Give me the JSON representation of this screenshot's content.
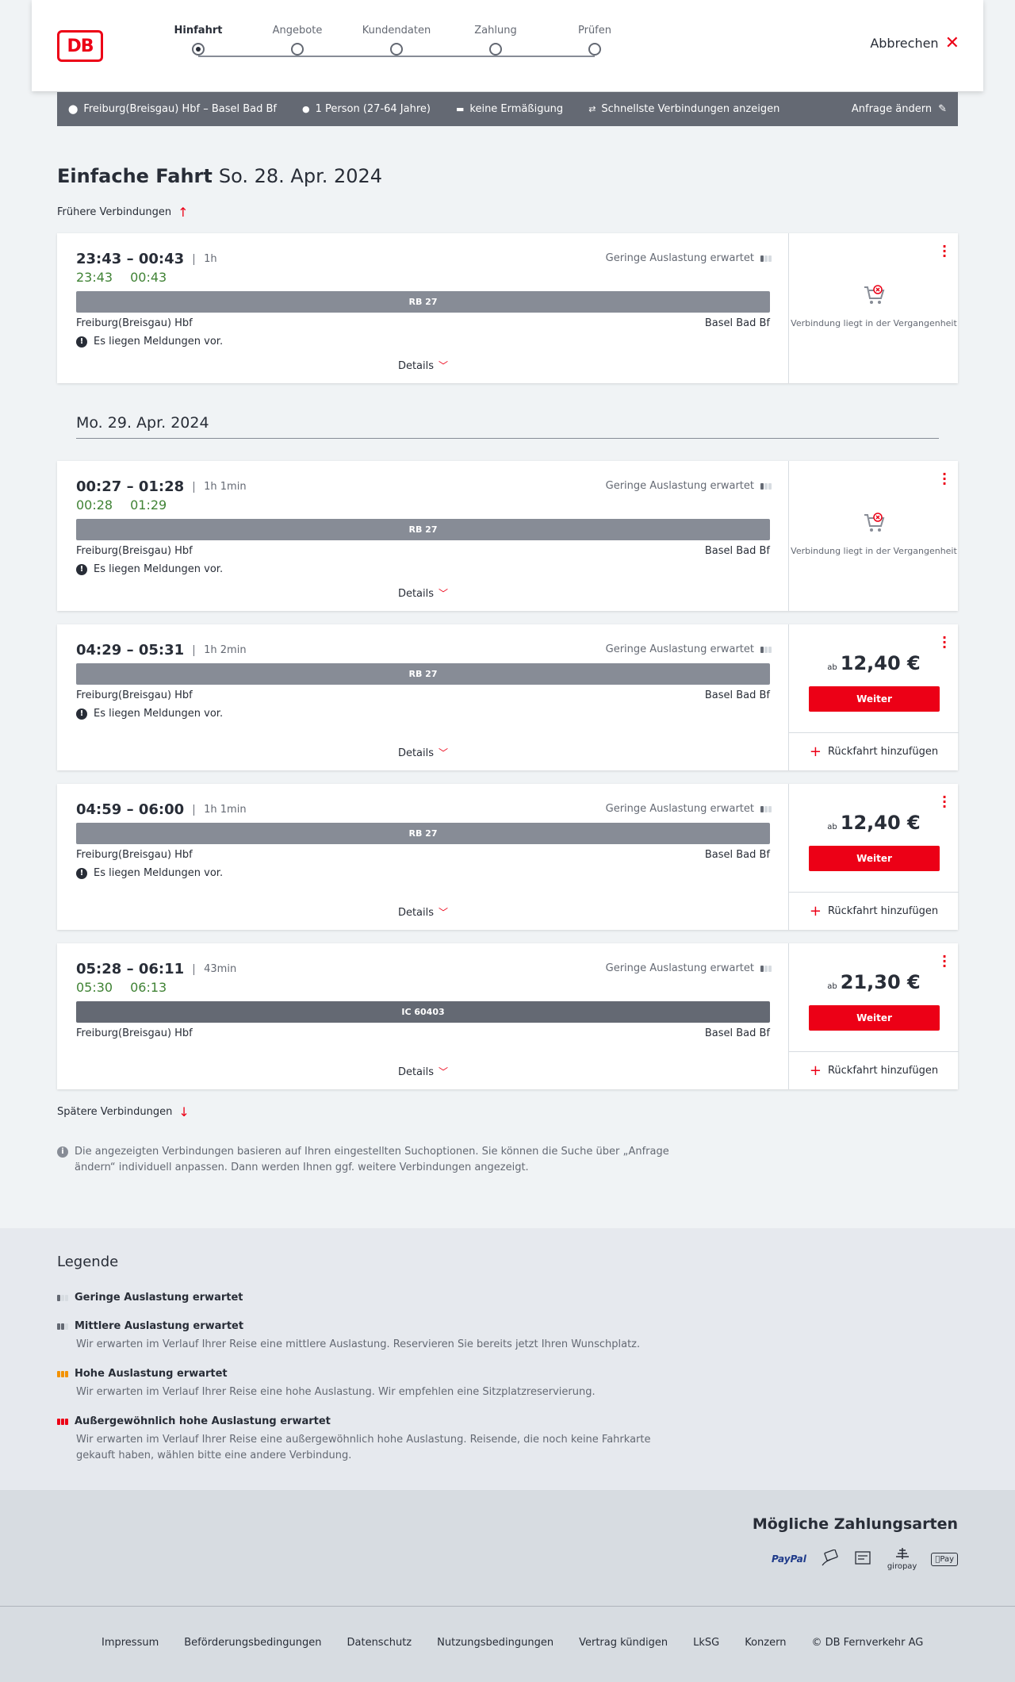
{
  "header": {
    "logo": "DB",
    "steps": [
      {
        "label": "Hinfahrt",
        "active": true
      },
      {
        "label": "Angebote",
        "active": false
      },
      {
        "label": "Kundendaten",
        "active": false
      },
      {
        "label": "Zahlung",
        "active": false
      },
      {
        "label": "Prüfen",
        "active": false
      }
    ],
    "cancel_label": "Abbrechen"
  },
  "search": {
    "route": "Freiburg(Breisgau) Hbf – Basel Bad Bf",
    "travellers": "1 Person (27-64 Jahre)",
    "discount": "keine Ermäßigung",
    "option": "Schnellste Verbindungen anzeigen",
    "change_label": "Anfrage ändern"
  },
  "heading": {
    "title": "Einfache Fahrt",
    "date": "So. 28. Apr. 2024"
  },
  "earlier_label": "Frühere Verbindungen",
  "later_label": "Spätere Verbindungen",
  "date_separator": "Mo. 29. Apr. 2024",
  "connections": [
    {
      "times": "23:43 – 00:43",
      "duration": "1h",
      "realtime_dep": "23:43",
      "realtime_arr": "00:43",
      "occupancy": "Geringe Auslastung erwartet",
      "train": "RB 27",
      "from": "Freiburg(Breisgau) Hbf",
      "to": "Basel Bad Bf",
      "message": "Es liegen Meldungen vor.",
      "details": "Details",
      "past_text": "Verbindung liegt in der Vergangenheit"
    },
    {
      "times": "00:27 – 01:28",
      "duration": "1h 1min",
      "realtime_dep": "00:28",
      "realtime_arr": "01:29",
      "occupancy": "Geringe Auslastung erwartet",
      "train": "RB 27",
      "from": "Freiburg(Breisgau) Hbf",
      "to": "Basel Bad Bf",
      "message": "Es liegen Meldungen vor.",
      "details": "Details",
      "past_text": "Verbindung liegt in der Vergangenheit"
    },
    {
      "times": "04:29 – 05:31",
      "duration": "1h 2min",
      "occupancy": "Geringe Auslastung erwartet",
      "train": "RB 27",
      "from": "Freiburg(Breisgau) Hbf",
      "to": "Basel Bad Bf",
      "message": "Es liegen Meldungen vor.",
      "details": "Details",
      "price_prefix": "ab",
      "price": "12,40 €",
      "button": "Weiter",
      "return_label": "Rückfahrt hinzufügen"
    },
    {
      "times": "04:59 – 06:00",
      "duration": "1h 1min",
      "occupancy": "Geringe Auslastung erwartet",
      "train": "RB 27",
      "from": "Freiburg(Breisgau) Hbf",
      "to": "Basel Bad Bf",
      "message": "Es liegen Meldungen vor.",
      "details": "Details",
      "price_prefix": "ab",
      "price": "12,40 €",
      "button": "Weiter",
      "return_label": "Rückfahrt hinzufügen"
    },
    {
      "times": "05:28 – 06:11",
      "duration": "43min",
      "realtime_dep": "05:30",
      "realtime_arr": "06:13",
      "occupancy": "Geringe Auslastung erwartet",
      "train": "IC 60403",
      "from": "Freiburg(Breisgau) Hbf",
      "to": "Basel Bad Bf",
      "details": "Details",
      "price_prefix": "ab",
      "price": "21,30 €",
      "button": "Weiter",
      "return_label": "Rückfahrt hinzufügen"
    }
  ],
  "info_text": "Die angezeigten Verbindungen basieren auf Ihren eingestellten Suchoptionen. Sie können die Suche über „Anfrage ändern“ individuell anpassen. Dann werden Ihnen ggf. weitere Verbindungen angezeigt.",
  "legend": {
    "title": "Legende",
    "items": [
      {
        "title": "Geringe Auslastung erwartet",
        "text": ""
      },
      {
        "title": "Mittlere Auslastung erwartet",
        "text": "Wir erwarten im Verlauf Ihrer Reise eine mittlere Auslastung. Reservieren Sie bereits jetzt Ihren Wunschplatz."
      },
      {
        "title": "Hohe Auslastung erwartet",
        "text": "Wir erwarten im Verlauf Ihrer Reise eine hohe Auslastung. Wir empfehlen eine Sitzplatzreservierung."
      },
      {
        "title": "Außergewöhnlich hohe Auslastung erwartet",
        "text": "Wir erwarten im Verlauf Ihrer Reise eine außergewöhnlich hohe Auslastung. Reisende, die noch keine Fahrkarte gekauft haben, wählen bitte eine andere Verbindung."
      }
    ],
    "colors": {
      "low": "#646973",
      "mid": "#646973",
      "high": "#f39200",
      "extreme": "#ec0016"
    }
  },
  "payment": {
    "title": "Mögliche Zahlungsarten",
    "methods": [
      "PayPal",
      "giropay",
      "Pay"
    ]
  },
  "footer": {
    "links": [
      "Impressum",
      "Beförderungsbedingungen",
      "Datenschutz",
      "Nutzungsbedingungen",
      "Vertrag kündigen",
      "LkSG",
      "Konzern",
      "© DB Fernverkehr AG"
    ]
  },
  "colors": {
    "accent": "#ec0016",
    "realtime": "#408335",
    "bar": "#646973"
  }
}
